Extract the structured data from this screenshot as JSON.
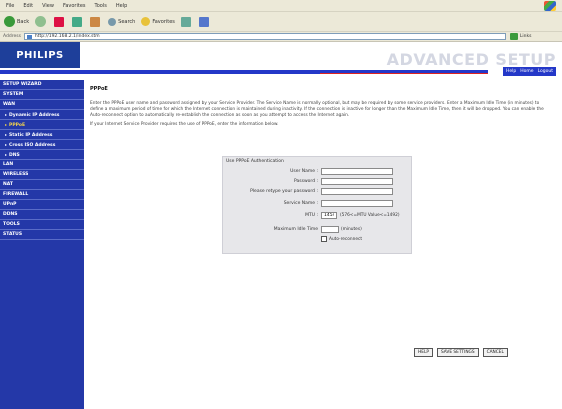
{
  "browser": {
    "menu": [
      "File",
      "Edit",
      "View",
      "Favorites",
      "Tools",
      "Help"
    ],
    "toolbar": {
      "back": "Back",
      "search": "Search",
      "favorites": "Favorites"
    },
    "address_label": "Address",
    "address_value": "http://192.168.2.1/index.stm",
    "go": "Go",
    "links": "Links"
  },
  "brand": {
    "logo": "PHILIPS",
    "title": "ADVANCED SETUP"
  },
  "top_links": {
    "help": "Help",
    "home": "Home",
    "logout": "Logout"
  },
  "sidebar": [
    {
      "label": "SETUP WIZARD",
      "sub": false,
      "active": false
    },
    {
      "label": "SYSTEM",
      "sub": false,
      "active": false
    },
    {
      "label": "WAN",
      "sub": false,
      "active": false
    },
    {
      "label": "Dynamic IP Address",
      "sub": true,
      "active": false
    },
    {
      "label": "PPPoE",
      "sub": true,
      "active": true
    },
    {
      "label": "Static IP Address",
      "sub": true,
      "active": false
    },
    {
      "label": "Cross ISO Address",
      "sub": true,
      "active": false
    },
    {
      "label": "DNS",
      "sub": true,
      "active": false
    },
    {
      "label": "LAN",
      "sub": false,
      "active": false
    },
    {
      "label": "WIRELESS",
      "sub": false,
      "active": false
    },
    {
      "label": "NAT",
      "sub": false,
      "active": false
    },
    {
      "label": "FIREWALL",
      "sub": false,
      "active": false
    },
    {
      "label": "UPnP",
      "sub": false,
      "active": false
    },
    {
      "label": "DDNS",
      "sub": false,
      "active": false
    },
    {
      "label": "TOOLS",
      "sub": false,
      "active": false
    },
    {
      "label": "STATUS",
      "sub": false,
      "active": false
    }
  ],
  "main": {
    "title": "PPPoE",
    "desc1": "Enter the PPPoE user name and password assigned by your Service Provider. The Service Name is normally optional, but may be required by some service providers. Enter a Maximum Idle Time (in minutes) to define a maximum period of time for which the Internet connection is maintained during inactivity. If the connection is inactive for longer than the Maximum Idle Time, then it will be dropped. You can enable the Auto-reconnect option to automatically re-establish the connection as soon as you attempt to access the Internet again.",
    "desc2": "If your Internet Service Provider requires the use of PPPoE, enter the information below."
  },
  "form": {
    "heading": "Use PPPoE Authentication",
    "user_name": "User Name :",
    "password": "Password :",
    "retype": "Please retype your password :",
    "service_name": "Service Name :",
    "mtu": "MTU :",
    "mtu_value": "1454",
    "mtu_note": "(576<=MTU Value<=1492)",
    "max_idle": "Maximum Idle Time",
    "minutes": "(minutes)",
    "auto_reconnect": "Auto-reconnect"
  },
  "buttons": {
    "help": "HELP",
    "save": "SAVE SETTINGS",
    "cancel": "CANCEL"
  }
}
